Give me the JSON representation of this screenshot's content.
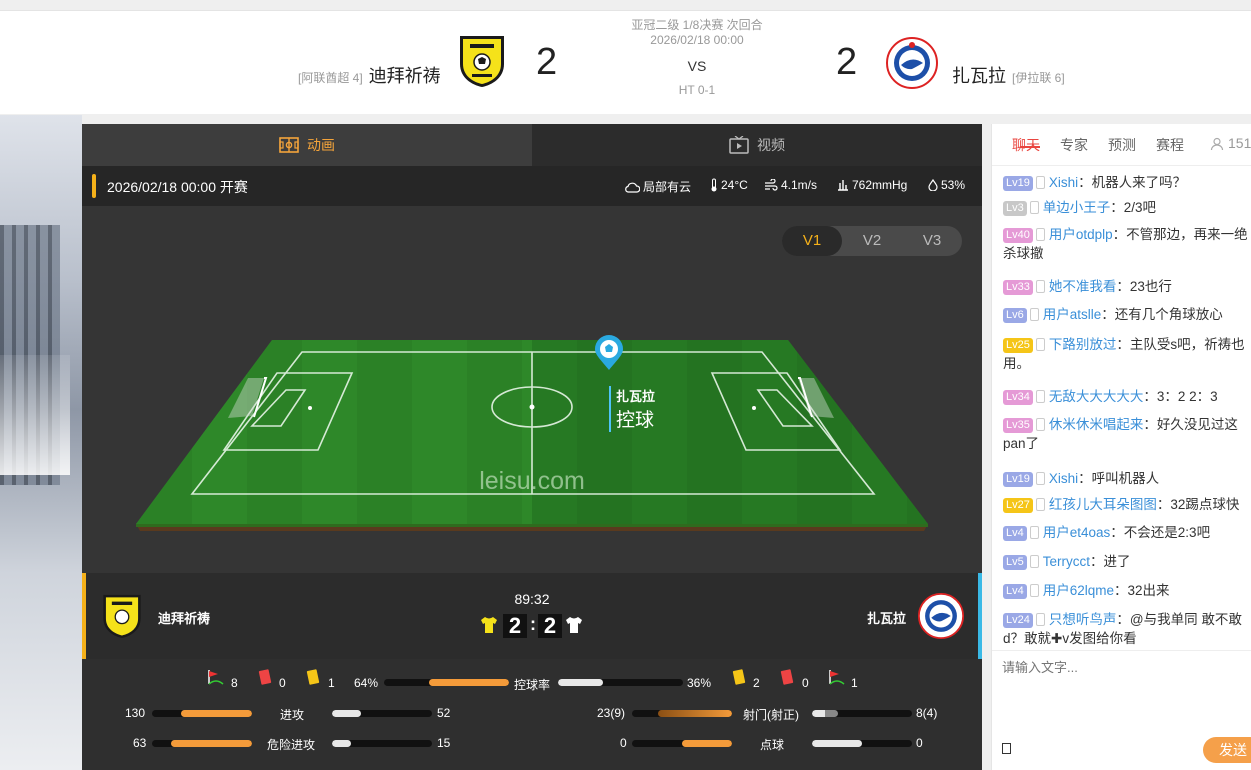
{
  "header": {
    "home": {
      "league": "[阿联酋超 4]",
      "name": "迪拜祈祷",
      "score": "2"
    },
    "away": {
      "league": "[伊拉联 6]",
      "name": "扎瓦拉",
      "score": "2"
    },
    "competition": "亚冠二级 1/8决赛 次回合",
    "datetime": "2026/02/18 00:00",
    "vs": "VS",
    "halftime": "HT 0-1"
  },
  "tabs": [
    {
      "label": "动画",
      "icon": "pitch-icon",
      "active": true
    },
    {
      "label": "视频",
      "icon": "tv-icon",
      "active": false
    }
  ],
  "info": {
    "start": "2026/02/18 00:00 开赛",
    "weather": "局部有云",
    "temperature": "24°C",
    "wind": "4.1m/s",
    "pressure": "762mmHg",
    "humidity": "53%"
  },
  "view_switch": [
    "V1",
    "V2",
    "V3"
  ],
  "field": {
    "watermark": "leisu.com",
    "possession_team": "扎瓦拉",
    "possession_text": "控球"
  },
  "scorebar": {
    "home_name": "迪拜祈祷",
    "away_name": "扎瓦拉",
    "clock": "89:32",
    "home_score": "2",
    "away_score": "2",
    "separator": ":"
  },
  "stats": {
    "home_corners": "8",
    "home_red": "0",
    "home_yellow": "1",
    "home_possession": "64%",
    "possession_label": "控球率",
    "away_possession": "36%",
    "away_yellow": "2",
    "away_red": "0",
    "away_corners": "1",
    "home_attacks": "130",
    "attacks_label": "进攻",
    "away_attacks": "52",
    "home_dangerous": "63",
    "dangerous_label": "危险进攻",
    "away_dangerous": "15",
    "home_shots": "23(9)",
    "shots_label": "射门(射正)",
    "away_shots": "8(4)",
    "home_penalties": "0",
    "penalties_label": "点球",
    "away_penalties": "0",
    "bars": {
      "possession": [
        0.64,
        0.36
      ],
      "attacks": [
        0.71,
        0.29
      ],
      "dangerous": [
        0.81,
        0.19
      ],
      "shots": [
        0.74,
        0.26
      ],
      "penalties": [
        0.5,
        0.5
      ]
    }
  },
  "chat": {
    "tabs": [
      "聊天",
      "专家",
      "预测",
      "赛程"
    ],
    "online": "151",
    "messages": [
      {
        "lv": "Lv19",
        "lvcolor": "#9aa8e6",
        "name": "Xishi",
        "text": "：机器人来了吗？"
      },
      {
        "lv": "Lv3",
        "lvcolor": "#c8c8c8",
        "name": "单边小王子",
        "text": "：2/3吧"
      },
      {
        "lv": "Lv40",
        "lvcolor": "#e59ad6",
        "name": "用户otdplp",
        "text": "：不管那边，再来一绝杀球撤"
      },
      {
        "lv": "Lv33",
        "lvcolor": "#e59ad6",
        "name": "她不准我看",
        "text": "：23也行"
      },
      {
        "lv": "Lv6",
        "lvcolor": "#9aa8e6",
        "name": "用户atslle",
        "text": "：还有几个角球放心"
      },
      {
        "lv": "Lv25",
        "lvcolor": "#f5c518",
        "name": "下路别放过",
        "text": "：主队受s吧，祈祷也用。"
      },
      {
        "lv": "Lv34",
        "lvcolor": "#e59ad6",
        "name": "无敌大大大大大",
        "text": "：3：2 2：3"
      },
      {
        "lv": "Lv35",
        "lvcolor": "#e59ad6",
        "name": "休米休米唱起来",
        "text": "：好久没见过这pan了"
      },
      {
        "lv": "Lv19",
        "lvcolor": "#9aa8e6",
        "name": "Xishi",
        "text": "：呼叫机器人"
      },
      {
        "lv": "Lv27",
        "lvcolor": "#f5c518",
        "name": "红孩儿大耳朵图图",
        "text": "：32踢点球快"
      },
      {
        "lv": "Lv4",
        "lvcolor": "#9aa8e6",
        "name": "用户et4oas",
        "text": "：不会还是2:3吧"
      },
      {
        "lv": "Lv5",
        "lvcolor": "#9aa8e6",
        "name": "Terrycct",
        "text": "：进了"
      },
      {
        "lv": "Lv4",
        "lvcolor": "#9aa8e6",
        "name": "用户62lqme",
        "text": "：32出来"
      },
      {
        "lv": "Lv24",
        "lvcolor": "#9aa8e6",
        "name": "只想听鸟声",
        "text": "：@与我单同 敢不敢d？敢就✚v发图给你看"
      }
    ],
    "input_placeholder": "请输入文字...",
    "send_label": "发送"
  },
  "colors": {
    "accent": "#f4a43b",
    "home_kit": "#f5e21a",
    "away_kit": "#ffffff",
    "chat_active": "#e9453f"
  }
}
